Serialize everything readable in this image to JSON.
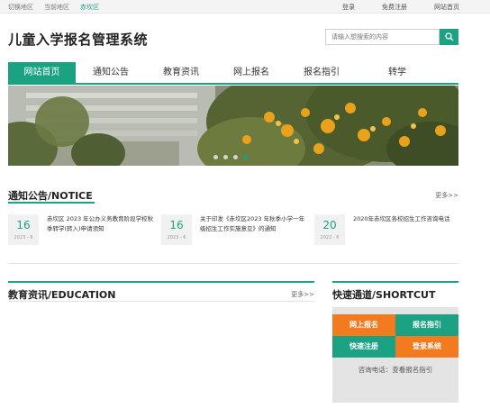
{
  "topbar": {
    "switch_region": "切换地区",
    "current_region_label": "当前地区",
    "current_region": "赤坎区",
    "login": "登录",
    "register": "免费注册",
    "home": "网站首页"
  },
  "header": {
    "title": "儿童入学报名管理系统",
    "search_placeholder": "请输入想搜索的内容"
  },
  "nav": {
    "items": [
      "网站首页",
      "通知公告",
      "教育资讯",
      "网上报名",
      "报名指引",
      "转学"
    ],
    "active_index": 0
  },
  "banner": {
    "slides": 4,
    "active_slide": 3
  },
  "notice": {
    "title": "通知公告/NOTICE",
    "more": "更多>>",
    "items": [
      {
        "day": "16",
        "ym": "2023 - 6",
        "text": "赤坎区 2023 年公办义务教育阶段学校秋季转学(转入)申请须知"
      },
      {
        "day": "16",
        "ym": "2023 - 6",
        "text": "关于印发《赤坎区2023 年秋季小学一年级招生工作实施意见》的通知"
      },
      {
        "day": "20",
        "ym": "2022 - 6",
        "text": "2020年赤坎区各校招生工作咨询电话"
      }
    ]
  },
  "education": {
    "title": "教育资讯/EDUCATION",
    "more": "更多>>"
  },
  "shortcut": {
    "title": "快速通道/SHORTCUT",
    "buttons": [
      "网上报名",
      "报名指引",
      "快速注册",
      "登录系统"
    ],
    "tel": "咨询电话：查看报名指引"
  },
  "colors": {
    "brand_green": "#1aa283",
    "accent_orange": "#f47a20"
  }
}
